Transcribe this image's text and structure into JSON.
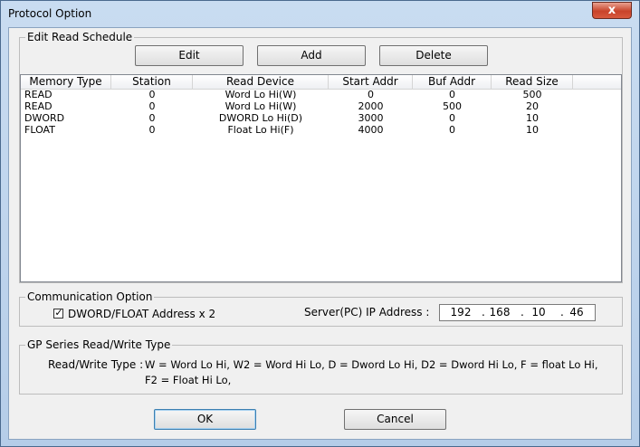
{
  "window": {
    "title": "Protocol Option",
    "close_glyph": "x"
  },
  "edit_group": {
    "label": "Edit Read Schedule",
    "buttons": {
      "edit": "Edit",
      "add": "Add",
      "delete": "Delete"
    },
    "columns": [
      "Memory Type",
      "Station",
      "Read Device",
      "Start Addr",
      "Buf Addr",
      "Read Size"
    ],
    "rows": [
      [
        "READ",
        "0",
        "Word Lo Hi(W)",
        "0",
        "0",
        "500"
      ],
      [
        "READ",
        "0",
        "Word Lo Hi(W)",
        "2000",
        "500",
        "20"
      ],
      [
        "DWORD",
        "0",
        "DWORD Lo Hi(D)",
        "3000",
        "0",
        "10"
      ],
      [
        "FLOAT",
        "0",
        "Float Lo Hi(F)",
        "4000",
        "0",
        "10"
      ]
    ]
  },
  "comm_group": {
    "label": "Communication Option",
    "checkbox_label": "DWORD/FLOAT Address x 2",
    "checkbox_checked": true,
    "check_glyph": "✓",
    "ip_label": "Server(PC) IP Address :",
    "ip_octets": [
      "192",
      "168",
      "10",
      "46"
    ],
    "ip_separator": "."
  },
  "gp_group": {
    "label": "GP Series Read/Write Type",
    "prefix": "Read/Write Type :",
    "line1": "W = Word Lo Hi, W2 = Word Hi Lo, D = Dword Lo Hi, D2 = Dword Hi Lo, F = float Lo Hi,",
    "line2": "F2 = Float Hi Lo,"
  },
  "footer": {
    "ok": "OK",
    "cancel": "Cancel"
  }
}
